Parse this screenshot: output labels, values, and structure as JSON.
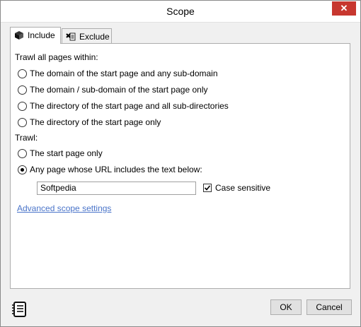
{
  "window": {
    "title": "Scope",
    "close_glyph": "✕"
  },
  "tabs": [
    {
      "label": "Include",
      "icon": "cube-icon",
      "active": true
    },
    {
      "label": "Exclude",
      "icon": "exclude-icon",
      "active": false
    }
  ],
  "trawl_within": {
    "heading": "Trawl all pages within:",
    "options": [
      {
        "label": "The domain of the start page and any sub-domain",
        "checked": false
      },
      {
        "label": "The domain / sub-domain of the start page only",
        "checked": false
      },
      {
        "label": "The directory of the start page and all sub-directories",
        "checked": false
      },
      {
        "label": "The directory of the start page only",
        "checked": false
      }
    ]
  },
  "trawl": {
    "heading": "Trawl:",
    "options": [
      {
        "label": "The start page only",
        "checked": false
      },
      {
        "label": "Any page whose URL includes the text below:",
        "checked": true
      }
    ]
  },
  "url_text": {
    "value": "Softpedia"
  },
  "case_sensitive": {
    "label": "Case sensitive",
    "checked": true
  },
  "advanced_link": "Advanced scope settings",
  "buttons": {
    "ok": "OK",
    "cancel": "Cancel"
  }
}
